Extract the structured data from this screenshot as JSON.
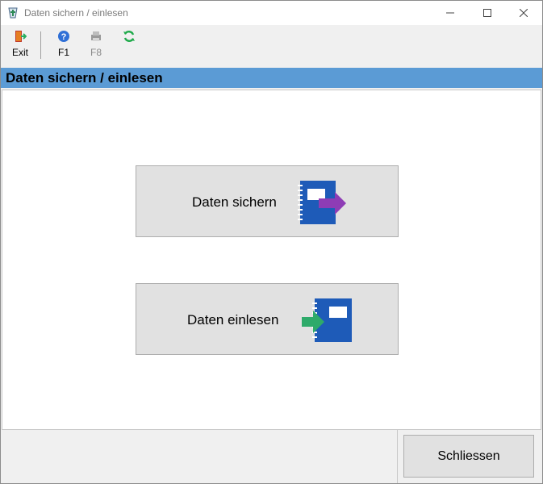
{
  "window": {
    "title": "Daten sichern / einlesen"
  },
  "toolbar": {
    "exit_label": "Exit",
    "f1_label": "F1",
    "f8_label": "F8",
    "exit_icon": "exit-door-icon",
    "f1_icon": "help-icon",
    "f8_icon": "print-icon",
    "refresh_icon": "refresh-icon"
  },
  "header": {
    "title": "Daten sichern / einlesen",
    "color": "#5b9bd5"
  },
  "main": {
    "save_button_label": "Daten sichern",
    "load_button_label": "Daten einlesen",
    "save_icon": "notebook-export-icon",
    "load_icon": "notebook-import-icon",
    "export_arrow_color": "#8e3cb5",
    "import_arrow_color": "#2eaa6a",
    "notebook_color": "#1e5bb8"
  },
  "footer": {
    "close_label": "Schliessen"
  }
}
